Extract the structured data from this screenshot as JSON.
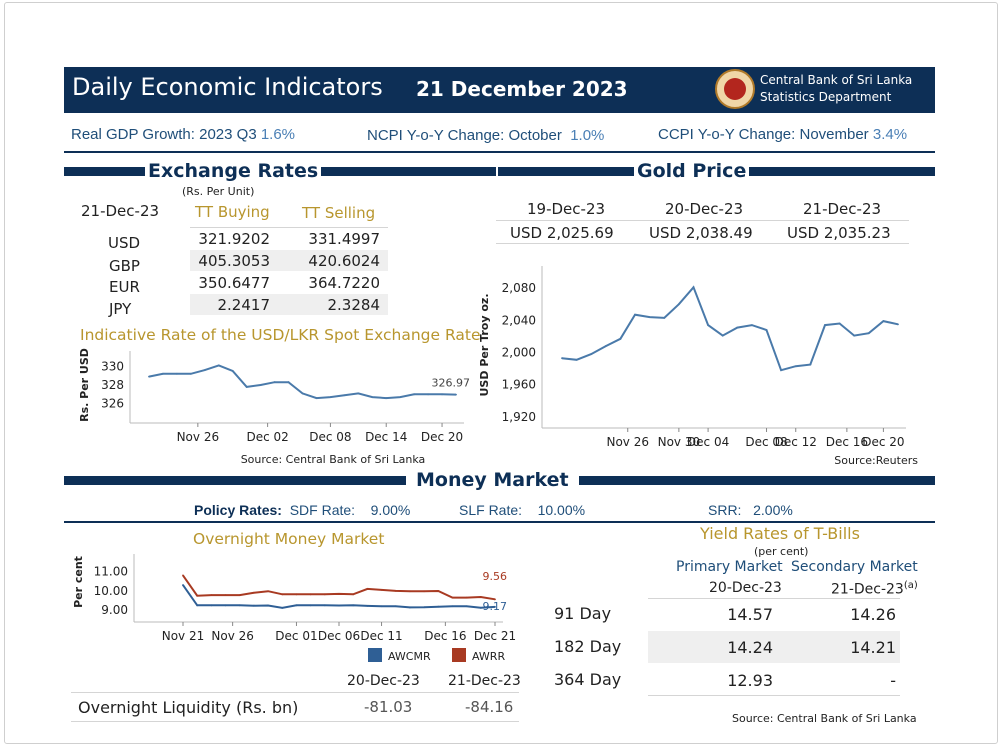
{
  "header": {
    "title": "Daily Economic Indicators",
    "date": "21 December 2023",
    "org_line1": "Central Bank of Sri Lanka",
    "org_line2": "Statistics Department"
  },
  "indicators": {
    "gdp_label": "Real GDP Growth:",
    "gdp_period": "2023  Q3",
    "gdp_value": "1.6%",
    "ncpi_label": "NCPI Y-o-Y Change:",
    "ncpi_period": "October",
    "ncpi_value": "1.0%",
    "ccpi_label": "CCPI Y-o-Y Change:",
    "ccpi_period": "November",
    "ccpi_value": "3.4%"
  },
  "exchange": {
    "title": "Exchange Rates",
    "unit": "(Rs. Per Unit)",
    "date": "21-Dec-23",
    "col_buy": "TT Buying",
    "col_sell": "TT Selling",
    "rows": [
      {
        "currency": "USD",
        "buy": "321.9202",
        "sell": "331.4997"
      },
      {
        "currency": "GBP",
        "buy": "405.3053",
        "sell": "420.6024"
      },
      {
        "currency": "EUR",
        "buy": "350.6477",
        "sell": "364.7220"
      },
      {
        "currency": "JPY",
        "buy": "2.2417",
        "sell": "2.3284"
      }
    ],
    "chart_title": "Indicative Rate of the USD/LKR Spot Exchange Rate",
    "chart_source": "Source: Central Bank of Sri Lanka"
  },
  "gold": {
    "title": "Gold Price",
    "dates": [
      "19-Dec-23",
      "20-Dec-23",
      "21-Dec-23"
    ],
    "prices": [
      "USD 2,025.69",
      "USD 2,038.49",
      "USD 2,035.23"
    ],
    "chart_source": "Source:Reuters"
  },
  "money": {
    "title": "Money Market",
    "policy_label": "Policy Rates:",
    "sdf_label": "SDF Rate:",
    "sdf_value": "9.00%",
    "slf_label": "SLF Rate:",
    "slf_value": "10.00%",
    "srr_label": "SRR:",
    "srr_value": "2.00%",
    "overnight_title": "Overnight Money Market",
    "liq_date1": "20-Dec-23",
    "liq_date2": "21-Dec-23",
    "liq_label": "Overnight Liquidity (Rs. bn)",
    "liq_value1": "-81.03",
    "liq_value2": "-84.16"
  },
  "tbills": {
    "title": "Yield Rates of T-Bills",
    "unit": "(per cent)",
    "primary_label": "Primary Market",
    "secondary_label": "Secondary Market",
    "primary_date": "20-Dec-23",
    "secondary_date": "21-Dec-23",
    "secondary_note": "(a)",
    "rows": [
      {
        "tenor": "91 Day",
        "primary": "14.57",
        "secondary": "14.26"
      },
      {
        "tenor": "182 Day",
        "primary": "14.24",
        "secondary": "14.21"
      },
      {
        "tenor": "364 Day",
        "primary": "12.93",
        "secondary": "-"
      }
    ],
    "source": "Source: Central Bank of Sri Lanka"
  },
  "colors": {
    "navy": "#0d2f56",
    "gold_text": "#b8962e",
    "line_blue": "#4a7aaa",
    "awcmr": "#2f5f95",
    "awrr": "#a83a22"
  },
  "chart_data": [
    {
      "type": "line",
      "title": "Indicative Rate of the USD/LKR Spot Exchange Rate",
      "ylabel": "Rs. Per USD",
      "xlabel": "",
      "ylim": [
        325,
        331
      ],
      "yticks": [
        "330",
        "328",
        "326"
      ],
      "xticks": [
        "Nov 26",
        "Dec 02",
        "Dec 08",
        "Dec 14",
        "Dec 20"
      ],
      "last_label": "326.97",
      "x": [
        "Nov 21",
        "Nov 22",
        "Nov 23",
        "Nov 24",
        "Nov 27",
        "Nov 28",
        "Nov 29",
        "Nov 30",
        "Dec 01",
        "Dec 04",
        "Dec 05",
        "Dec 06",
        "Dec 07",
        "Dec 08",
        "Dec 11",
        "Dec 12",
        "Dec 13",
        "Dec 14",
        "Dec 15",
        "Dec 18",
        "Dec 19",
        "Dec 20",
        "Dec 21"
      ],
      "series": [
        {
          "values": [
            328.9,
            329.2,
            329.2,
            329.2,
            329.6,
            330.1,
            329.5,
            327.8,
            328.0,
            328.3,
            328.3,
            327.1,
            326.6,
            326.7,
            326.9,
            327.1,
            326.7,
            326.6,
            326.7,
            327.0,
            327.0,
            327.0,
            326.97
          ]
        }
      ]
    },
    {
      "type": "line",
      "title": "",
      "ylabel": "USD Per Troy oz.",
      "xlabel": "",
      "ylim": [
        1910,
        2100
      ],
      "yticks": [
        "2,080",
        "2,040",
        "2,000",
        "1,960",
        "1,920"
      ],
      "xticks": [
        "Nov 26",
        "Nov 30",
        "Dec 04",
        "Dec 08",
        "Dec 12",
        "Dec 16",
        "Dec 20"
      ],
      "x": [
        "Nov 20",
        "Nov 21",
        "Nov 22",
        "Nov 23",
        "Nov 24",
        "Nov 27",
        "Nov 28",
        "Nov 29",
        "Nov 30",
        "Dec 01",
        "Dec 04",
        "Dec 05",
        "Dec 06",
        "Dec 07",
        "Dec 08",
        "Dec 11",
        "Dec 12",
        "Dec 13",
        "Dec 14",
        "Dec 15",
        "Dec 18",
        "Dec 19",
        "Dec 20",
        "Dec 21"
      ],
      "series": [
        {
          "values": [
            1993,
            1991,
            1998,
            2008,
            2017,
            2047,
            2044,
            2043,
            2060,
            2081,
            2034,
            2021,
            2031,
            2034,
            2028,
            1978,
            1983,
            1985,
            2034,
            2036,
            2021,
            2024,
            2039,
            2035
          ]
        }
      ]
    },
    {
      "type": "line",
      "title": "Overnight Money Market",
      "ylabel": "Per cent",
      "xlabel": "",
      "ylim": [
        8.8,
        11.6
      ],
      "yticks": [
        "11.00",
        "10.00",
        "9.00"
      ],
      "xticks": [
        "Nov 21",
        "Nov 26",
        "Dec 01",
        "Dec 06",
        "Dec 11",
        "Dec 16",
        "Dec 21"
      ],
      "x": [
        "Nov 21",
        "Nov 22",
        "Nov 23",
        "Nov 24",
        "Nov 27",
        "Nov 28",
        "Nov 29",
        "Nov 30",
        "Dec 01",
        "Dec 04",
        "Dec 05",
        "Dec 06",
        "Dec 07",
        "Dec 08",
        "Dec 11",
        "Dec 12",
        "Dec 13",
        "Dec 14",
        "Dec 15",
        "Dec 18",
        "Dec 19",
        "Dec 20",
        "Dec 21"
      ],
      "series": [
        {
          "name": "AWCMR",
          "values": [
            10.3,
            9.25,
            9.25,
            9.25,
            9.25,
            9.23,
            9.24,
            9.12,
            9.25,
            9.25,
            9.25,
            9.24,
            9.25,
            9.22,
            9.2,
            9.2,
            9.14,
            9.15,
            9.18,
            9.2,
            9.2,
            9.12,
            9.17
          ]
        },
        {
          "name": "AWRR",
          "values": [
            10.8,
            9.75,
            9.78,
            9.78,
            9.78,
            9.9,
            9.98,
            9.82,
            9.82,
            9.82,
            9.82,
            9.84,
            9.82,
            10.1,
            10.05,
            10.0,
            9.98,
            9.98,
            9.99,
            9.65,
            9.65,
            9.68,
            9.56
          ]
        }
      ],
      "last_labels": [
        "9.56",
        "9.17"
      ],
      "legend": "bottom-right"
    }
  ]
}
